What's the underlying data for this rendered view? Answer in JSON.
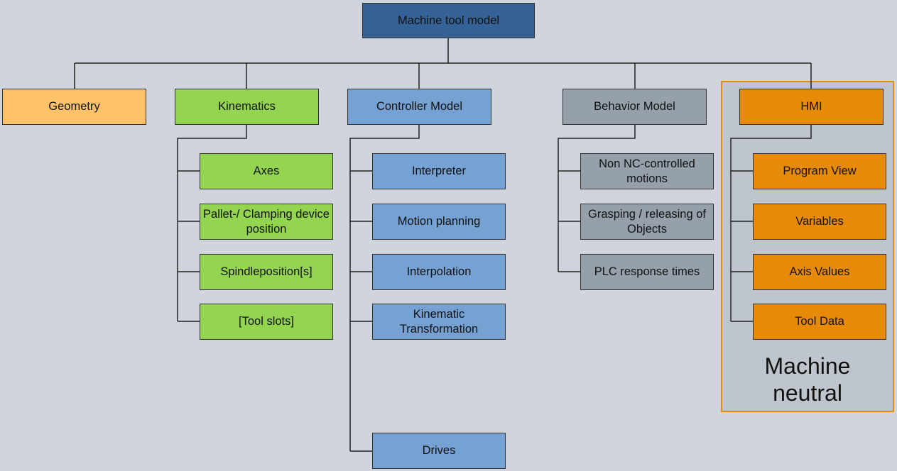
{
  "root": "Machine tool model",
  "categories": {
    "geometry": {
      "label": "Geometry",
      "color": "#fec368"
    },
    "kinematics": {
      "label": "Kinematics",
      "color": "#93d450",
      "children": [
        "Axes",
        "Pallet-/ Clamping device position",
        "Spindleposition[s]",
        "[Tool slots]"
      ]
    },
    "controller": {
      "label": "Controller Model",
      "color": "#75a2d2",
      "children": [
        "Interpreter",
        "Motion planning",
        "Interpolation",
        "Kinematic Transformation",
        "Drives"
      ]
    },
    "behavior": {
      "label": "Behavior Model",
      "color": "#96a0ab",
      "children": [
        "Non NC-controlled motions",
        "Grasping / releasing of Objects",
        "PLC response times"
      ]
    },
    "hmi": {
      "label": "HMI",
      "color": "#e68a07",
      "children": [
        "Program View",
        "Variables",
        "Axis Values",
        "Tool Data"
      ]
    }
  },
  "group_label": "Machine neutral"
}
